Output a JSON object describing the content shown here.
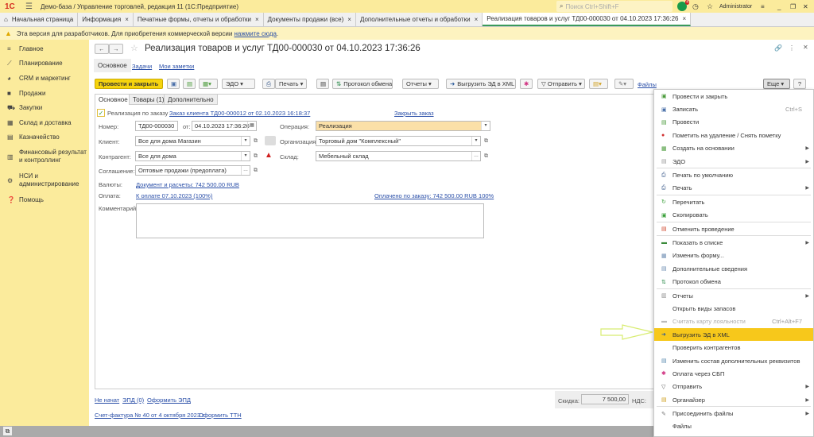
{
  "titlebar": {
    "logo": "1С",
    "title": "Демо-база / Управление торговлей, редакция 11  (1С:Предприятие)",
    "search_placeholder": "Поиск Ctrl+Shift+F",
    "notifications": "4",
    "user": "Administrator"
  },
  "tabs": [
    {
      "label": "Начальная страница",
      "closable": false
    },
    {
      "label": "Информация"
    },
    {
      "label": "Печатные формы, отчеты и обработки"
    },
    {
      "label": "Документы продажи (все)"
    },
    {
      "label": "Дополнительные отчеты и обработки"
    },
    {
      "label": "Реализация товаров и услуг ТД00-000030 от 04.10.2023 17:36:26",
      "active": true
    }
  ],
  "notice": {
    "text": "Эта версия для разработчиков. Для приобретения коммерческой версии ",
    "link": "нажмите сюда",
    "end": "."
  },
  "sidebar": {
    "items": [
      {
        "label": "Главное",
        "icon": "menu-icon"
      },
      {
        "label": "Планирование",
        "icon": "chart-icon"
      },
      {
        "label": "CRM и маркетинг",
        "icon": "pie-icon"
      },
      {
        "label": "Продажи",
        "icon": "bag-icon"
      },
      {
        "label": "Закупки",
        "icon": "cart-icon"
      },
      {
        "label": "Склад и доставка",
        "icon": "grid-icon"
      },
      {
        "label": "Казначейство",
        "icon": "coins-icon"
      },
      {
        "label": "Финансовый результат и контроллинг",
        "icon": "bar-chart-icon"
      },
      {
        "label": "НСИ и администрирование",
        "icon": "gear-icon"
      },
      {
        "label": "Помощь",
        "icon": "help-icon"
      }
    ]
  },
  "doc": {
    "title": "Реализация товаров и услуг ТД00-000030 от 04.10.2023 17:36:26",
    "nav": [
      "Основное",
      "Задачи",
      "Мои заметки"
    ],
    "toolbar": {
      "post_close": "Провести и закрыть",
      "edo": "ЭДО",
      "print": "Печать",
      "exchange_log": "Протокол обмена",
      "reports": "Отчеты",
      "export_xml": "Выгрузить ЭД в XML",
      "send": "Отправить",
      "files": "Файлы",
      "more": "Еще",
      "help": "?"
    },
    "form_tabs": [
      "Основное",
      "Товары (1)",
      "Дополнительно"
    ],
    "by_order_label": "Реализация по заказу",
    "by_order_checked": true,
    "order_link": "Заказ клиента ТД00-000012 от 02.10.2023 16:18:37",
    "close_order": "Закрыть заказ",
    "number_label": "Номер:",
    "number": "ТД00-000030",
    "date_label": "от:",
    "date": "04.10.2023 17:36:26",
    "client_label": "Клиент:",
    "client": "Все для дома Магазин",
    "contractor_label": "Контрагент:",
    "contractor": "Все для дома",
    "agreement_label": "Соглашение:",
    "agreement": "Оптовые продажи (предоплата)",
    "operation_label": "Операция:",
    "operation": "Реализация",
    "org_label": "Организация:",
    "org": "Торговый дом \"Комплексный\"",
    "warehouse_label": "Склад:",
    "warehouse": "Мебельный склад",
    "currency_label": "Валюты:",
    "currency_link": "Документ и расчеты: 742 500.00 RUB",
    "payment_label": "Оплата:",
    "payment_link": "К оплате 07.10.2023 (100%)",
    "paid_link": "Оплачено по заказу: 742 500.00 RUB 100%",
    "comment_label": "Комментарий:",
    "comment": "",
    "footer": {
      "status": "Не начат",
      "edo": "ЭПД (0)",
      "make_edo": "Оформить ЭПД",
      "invoice": "Счет-фактура № 40 от 4 октября 2023 г.",
      "make_ttn": "Оформить ТТН",
      "discount_label": "Скидка:",
      "discount": "7 500,00",
      "vat_label": "НДС:"
    }
  },
  "menu": [
    {
      "label": "Провести и закрыть",
      "icon": "post-close-icon",
      "color": "#4a9a3a"
    },
    {
      "label": "Записать",
      "shortcut": "Ctrl+S",
      "icon": "save-icon",
      "color": "#4a6fa8"
    },
    {
      "label": "Провести",
      "icon": "post-icon",
      "color": "#4a9a3a"
    },
    {
      "label": "Пометить на удаление / Снять пометку",
      "icon": "delete-mark-icon",
      "color": "#d03030"
    },
    {
      "label": "Создать на основании",
      "sub": true,
      "icon": "create-based-icon",
      "color": "#4a9a3a"
    },
    {
      "label": "ЭДО",
      "sub": true,
      "icon": "edo-icon",
      "color": "#999",
      "sep_after": true
    },
    {
      "label": "Печать по умолчанию",
      "icon": "printer-icon",
      "color": "#3a5a8a"
    },
    {
      "label": "Печать",
      "sub": true,
      "icon": "printer-icon",
      "color": "#3a5a8a",
      "sep_after": true
    },
    {
      "label": "Перечитать",
      "icon": "refresh-icon",
      "color": "#3aa03a"
    },
    {
      "label": "Скопировать",
      "icon": "copy-icon",
      "color": "#3aa03a",
      "sep_after": true
    },
    {
      "label": "Отменить проведение",
      "icon": "unpost-icon",
      "color": "#d04a30",
      "sep_after": true
    },
    {
      "label": "Показать в списке",
      "sub": true,
      "icon": "list-icon",
      "color": "#3a8a3a"
    },
    {
      "label": "Изменить форму...",
      "icon": "form-icon",
      "color": "#6a8ab0"
    },
    {
      "label": "Дополнительные сведения",
      "icon": "info-icon",
      "color": "#6a8ab0"
    },
    {
      "label": "Протокол обмена",
      "icon": "exchange-icon",
      "color": "#2a8a4a",
      "sep_after": true
    },
    {
      "label": "Отчеты",
      "sub": true,
      "icon": "reports-icon",
      "color": "#8a8a8a"
    },
    {
      "label": "Открыть виды запасов",
      "icon": "",
      "color": ""
    },
    {
      "label": "Считать карту лояльности",
      "shortcut": "Ctrl+Alt+F7",
      "disabled": true,
      "icon": "card-icon",
      "color": "#bbb"
    },
    {
      "label": "Выгрузить ЭД в XML",
      "highlighted": true,
      "icon": "export-icon",
      "color": "#2a5a9a"
    },
    {
      "label": "Проверить контрагентов",
      "icon": "",
      "color": ""
    },
    {
      "label": "Изменить состав дополнительных реквизитов",
      "icon": "attributes-icon",
      "color": "#5a8ab0"
    },
    {
      "label": "Оплата через СБП",
      "icon": "sbp-icon",
      "color": "#d03080"
    },
    {
      "label": "Отправить",
      "sub": true,
      "icon": "send-icon",
      "color": "#555"
    },
    {
      "label": "Органайзер",
      "sub": true,
      "icon": "organizer-icon",
      "color": "#d0a020",
      "sep_after": true
    },
    {
      "label": "Присоединить файлы",
      "sub": true,
      "icon": "paperclip-icon",
      "color": "#777"
    },
    {
      "label": "Файлы",
      "icon": "",
      "color": ""
    }
  ],
  "colors": {
    "accent": "#f6d40e",
    "sidebar": "#fbeb9c",
    "highlight": "#f7c81b",
    "link": "#2a4fa8"
  }
}
